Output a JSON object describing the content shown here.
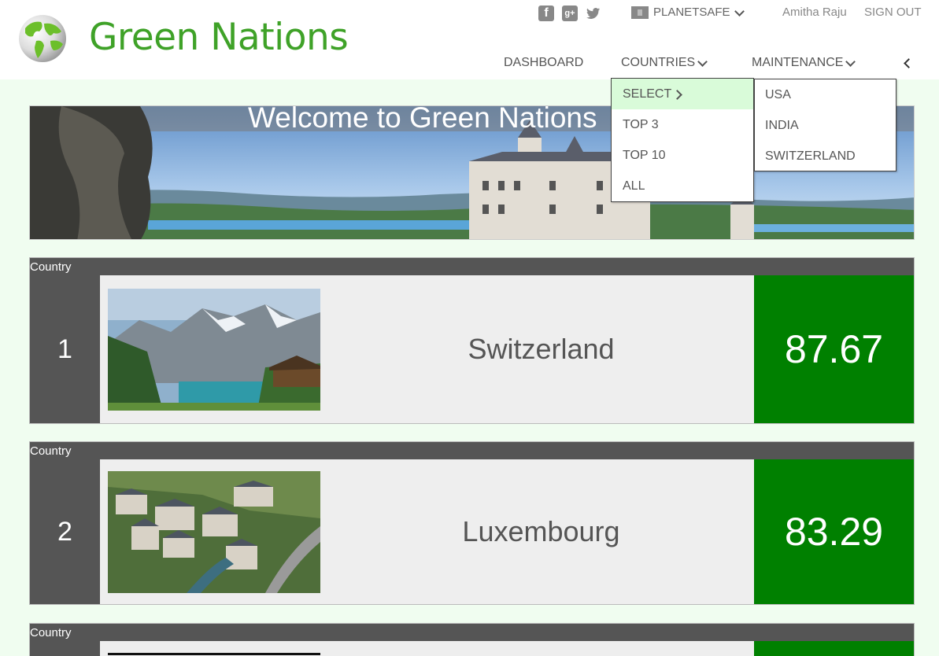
{
  "header": {
    "brand": "Green Nations",
    "social": [
      {
        "name": "facebook-icon",
        "glyph": "f"
      },
      {
        "name": "google-plus-icon",
        "glyph": "g+"
      },
      {
        "name": "twitter-icon",
        "glyph": "t"
      }
    ],
    "planet_label": "PLANETSAFE",
    "user_name": "Amitha Raju",
    "sign_out": "SIGN OUT"
  },
  "nav": {
    "dashboard": "DASHBOARD",
    "countries": "COUNTRIES",
    "maintenance": "MAINTENANCE"
  },
  "countries_menu": {
    "items": [
      "SELECT",
      "TOP 3",
      "TOP 10",
      "ALL"
    ],
    "submenu": [
      "USA",
      "INDIA",
      "SWITZERLAND"
    ]
  },
  "banner": {
    "title": "Welcome to Green Nations"
  },
  "cards": [
    {
      "header": "Country",
      "rank": "1",
      "name": "Switzerland",
      "score": "87.67"
    },
    {
      "header": "Country",
      "rank": "2",
      "name": "Luxembourg",
      "score": "83.29"
    },
    {
      "header": "Country",
      "rank": "",
      "name": "",
      "score": ""
    }
  ],
  "colors": {
    "brand_green": "#3fa228",
    "score_green": "#008000",
    "card_dark": "#555555",
    "page_bg": "#f0fdf0",
    "menu_active": "#d9fbd9"
  }
}
